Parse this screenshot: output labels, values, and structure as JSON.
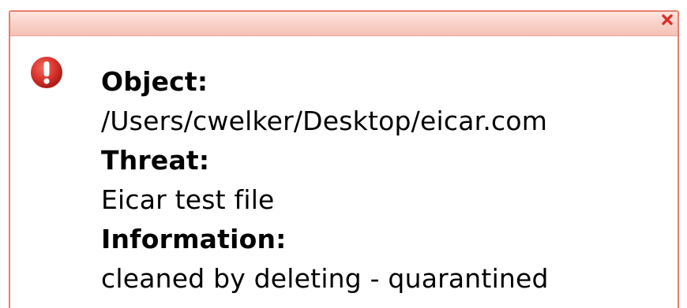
{
  "alert": {
    "close_icon": "close-icon",
    "status_icon": "exclamation-icon",
    "colors": {
      "border": "#e8806f",
      "titlebar": "#f9cfc6",
      "close": "#d9322b",
      "icon": "#d9322b"
    },
    "fields": [
      {
        "label": "Object:",
        "value": "/Users/cwelker/Desktop/eicar.com"
      },
      {
        "label": "Threat:",
        "value": "Eicar test file"
      },
      {
        "label": "Information:",
        "value": "cleaned by deleting - quarantined"
      }
    ]
  }
}
